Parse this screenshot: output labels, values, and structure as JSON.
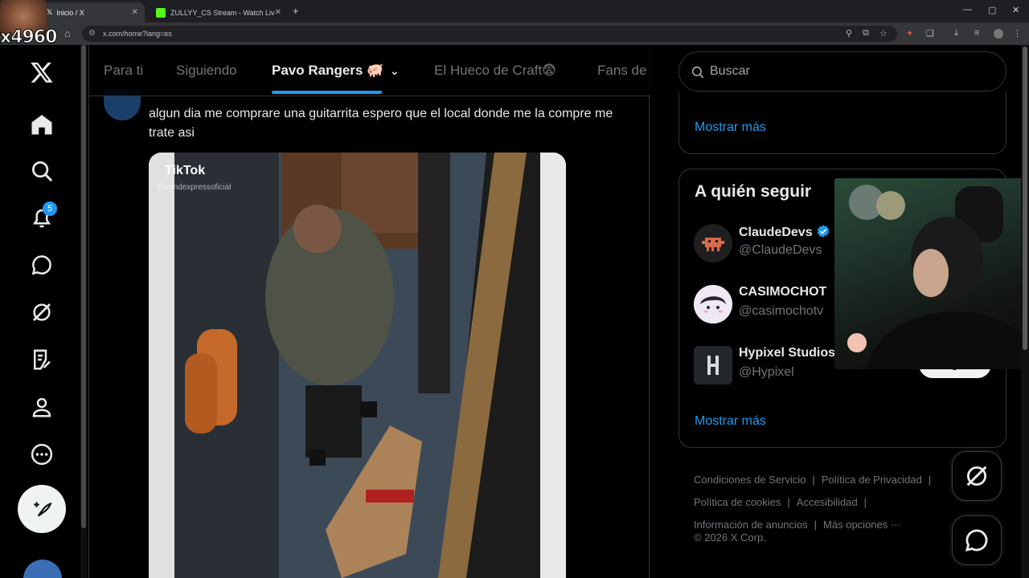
{
  "browser": {
    "tabs": [
      {
        "title": "Inicio / X",
        "active": true
      },
      {
        "title": "ZULLYY_CS Stream - Watch Liv",
        "active": false
      }
    ],
    "url": "x.com/home?lang=es"
  },
  "overlay": {
    "counter": "x4960"
  },
  "nav": {
    "notification_count": "5"
  },
  "timeline_tabs": [
    "Para ti",
    "Siguiendo",
    "Pavo Rangers 🐖",
    "El Hueco de Craft😨",
    "Fans de"
  ],
  "tweet": {
    "text": "algun dia me comprare una guitarrita espero que el local donde me la compre me trate asi",
    "media": {
      "watermark": "TikTok",
      "handle": "@vandexpressoficial"
    }
  },
  "search": {
    "placeholder": "Buscar"
  },
  "trends_card": {
    "show_more": "Mostrar más"
  },
  "who_to_follow": {
    "title": "A quién seguir",
    "accounts": [
      {
        "name": "ClaudeDevs",
        "handle": "@ClaudeDevs",
        "verified": true
      },
      {
        "name": "CASIMOCHOT",
        "handle": "@casimochotv",
        "verified": false
      },
      {
        "name": "Hypixel Studios",
        "handle": "@Hypixel",
        "verified": false
      }
    ],
    "follow_label": "Seguir",
    "show_more": "Mostrar más"
  },
  "footer": {
    "links": [
      "Condiciones de Servicio",
      "Política de Privacidad",
      "Política de cookies",
      "Accesibilidad",
      "Información de anuncios",
      "Más opciones ···"
    ],
    "copyright": "© 2026 X Corp."
  },
  "colors": {
    "accent": "#1d9bf0",
    "background": "#000000",
    "text": "#e7e9ea",
    "muted": "#71767b"
  }
}
